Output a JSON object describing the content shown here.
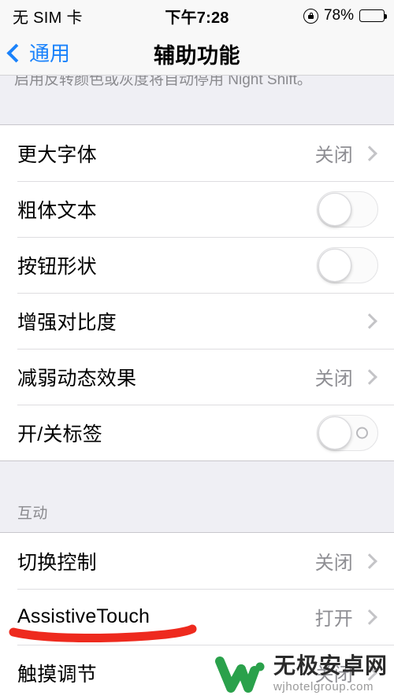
{
  "status_bar": {
    "carrier": "无 SIM 卡",
    "time": "下午7:28",
    "rotation_lock_icon": "rotation-lock-icon",
    "battery_percent": "78%",
    "battery_level": 78
  },
  "nav": {
    "back_label": "通用",
    "back_icon": "chevron-left-icon",
    "title": "辅助功能"
  },
  "footer_note": "启用反转颜色或灰度将自动停用 Night Shift。",
  "sections": [
    {
      "header": "",
      "rows": [
        {
          "label": "更大字体",
          "value": "关闭",
          "control": "chevron"
        },
        {
          "label": "粗体文本",
          "value": "",
          "control": "switch-off"
        },
        {
          "label": "按钮形状",
          "value": "",
          "control": "switch-off"
        },
        {
          "label": "增强对比度",
          "value": "",
          "control": "chevron"
        },
        {
          "label": "减弱动态效果",
          "value": "关闭",
          "control": "chevron"
        },
        {
          "label": "开/关标签",
          "value": "",
          "control": "switch-off-labeled"
        }
      ]
    },
    {
      "header": "互动",
      "rows": [
        {
          "label": "切换控制",
          "value": "关闭",
          "control": "chevron"
        },
        {
          "label": "AssistiveTouch",
          "value": "打开",
          "control": "chevron"
        },
        {
          "label": "触摸调节",
          "value": "关闭",
          "control": "chevron"
        }
      ]
    }
  ],
  "annotation": {
    "type": "red-underline",
    "color": "#ee2a1e"
  },
  "watermark": {
    "logo": "w-logo-icon",
    "title": "无极安卓网",
    "url": "wjhotelgroup.com",
    "logo_color": "#2aa14b"
  }
}
